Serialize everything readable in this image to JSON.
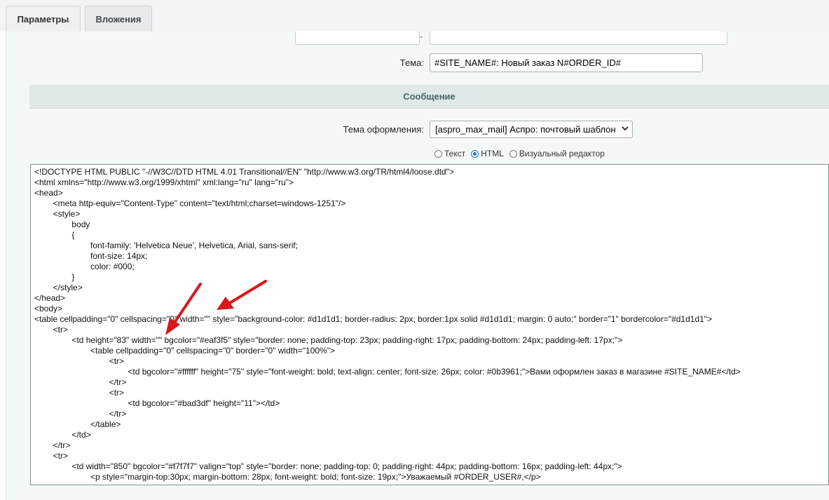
{
  "tabs": [
    {
      "label": "Параметры",
      "active": true
    },
    {
      "label": "Вложения",
      "active": false
    }
  ],
  "form": {
    "subject_label": "Тема:",
    "subject_value": "#SITE_NAME#: Новый заказ N#ORDER_ID#"
  },
  "message_section": {
    "title": "Сообщение",
    "theme_label": "Тема оформления:",
    "theme_value": "[aspro_max_mail] Аспро: почтовый шаблон",
    "editor_modes": [
      {
        "label": "Текст",
        "checked": false
      },
      {
        "label": "HTML",
        "checked": true
      },
      {
        "label": "Визуальный редактор",
        "checked": false
      }
    ]
  },
  "code_lines": [
    "<!DOCTYPE HTML PUBLIC \"-//W3C//DTD HTML 4.01 Transitional//EN\" \"http://www.w3.org/TR/html4/loose.dtd\">",
    "<html xmlns=\"http://www.w3.org/1999/xhtml\" xml:lang=\"ru\" lang=\"ru\">",
    "<head>",
    "\t<meta http-equiv=\"Content-Type\" content=\"text/html;charset=windows-1251\"/>",
    "\t<style>",
    "\t\tbody",
    "\t\t{",
    "\t\t\tfont-family: 'Helvetica Neue', Helvetica, Arial, sans-serif;",
    "\t\t\tfont-size: 14px;",
    "\t\t\tcolor: #000;",
    "\t\t}",
    "\t</style>",
    "</head>",
    "<body>",
    "<table cellpadding=\"0\" cellspacing=\"0\" width=\"\" style=\"background-color: #d1d1d1; border-radius: 2px; border:1px solid #d1d1d1; margin: 0 auto;\" border=\"1\" bordercolor=\"#d1d1d1\">",
    "\t<tr>",
    "\t\t<td height=\"83\" width=\"\" bgcolor=\"#eaf3f5\" style=\"border: none; padding-top: 23px; padding-right: 17px; padding-bottom: 24px; padding-left: 17px;\">",
    "\t\t\t<table cellpadding=\"0\" cellspacing=\"0\" border=\"0\" width=\"100%\">",
    "\t\t\t\t<tr>",
    "\t\t\t\t\t<td bgcolor=\"#ffffff\" height=\"75\" style=\"font-weight: bold; text-align: center; font-size: 26px; color: #0b3961;\">Вами оформлен заказ в магазине #SITE_NAME#</td>",
    "\t\t\t\t</tr>",
    "\t\t\t\t<tr>",
    "\t\t\t\t\t<td bgcolor=\"#bad3df\" height=\"11\"></td>",
    "\t\t\t\t</tr>",
    "\t\t\t</table>",
    "\t\t</td>",
    "\t</tr>",
    "\t<tr>",
    "\t\t<td width=\"850\" bgcolor=\"#f7f7f7\" valign=\"top\" style=\"border: none; padding-top: 0; padding-right: 44px; padding-bottom: 16px; padding-left: 44px;\">",
    "\t\t\t<p style=\"margin-top:30px; margin-bottom: 28px; font-weight: bold; font-size: 19px;\">Уважаемый #ORDER_USER#,</p>"
  ],
  "colors": {
    "arrow": "#d9171d",
    "radio_checked": "#1a73e8",
    "section_header_bg": "#e0e8ea"
  }
}
